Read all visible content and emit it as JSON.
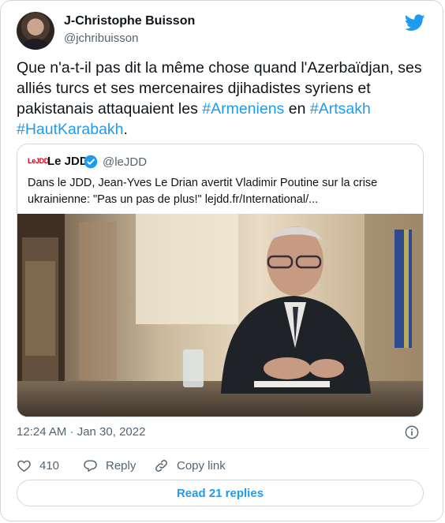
{
  "tweet": {
    "author": {
      "display_name": "J-Christophe Buisson",
      "handle": "@jchribuisson"
    },
    "text_parts": [
      {
        "text": "Que n'a-t-il pas dit la même chose quand l'Azerbaïdjan, ses alliés turcs et ses mercenaires djihadistes syriens et pakistanais attaquaient les ",
        "type": "text"
      },
      {
        "text": "#Armeniens",
        "type": "hashtag"
      },
      {
        "text": " en ",
        "type": "text"
      },
      {
        "text": "#Artsakh",
        "type": "hashtag"
      },
      {
        "text": " ",
        "type": "text"
      },
      {
        "text": "#HautKarabakh",
        "type": "hashtag"
      },
      {
        "text": ".",
        "type": "text"
      }
    ],
    "timestamp": "12:24 AM · Jan 30, 2022"
  },
  "quoted": {
    "logo_text": "LeJDD",
    "name": "Le JDD",
    "handle": "@leJDD",
    "text": "Dans le JDD, Jean-Yves Le Drian avertit Vladimir Poutine sur la crise ukrainienne: \"Pas un pas de plus!\" lejdd.fr/International/..."
  },
  "actions": {
    "like_count": "410",
    "reply_label": "Reply",
    "copy_link_label": "Copy link"
  },
  "footer": {
    "read_replies_label": "Read 21 replies"
  },
  "colors": {
    "accent": "#1d9bf0",
    "text": "#0f1419",
    "secondary": "#536471",
    "border": "#cfd9de",
    "jdd_red": "#d0021b"
  },
  "icons": [
    "twitter-bird-icon",
    "verified-badge-icon",
    "info-icon",
    "heart-icon",
    "reply-bubble-icon",
    "link-icon"
  ]
}
